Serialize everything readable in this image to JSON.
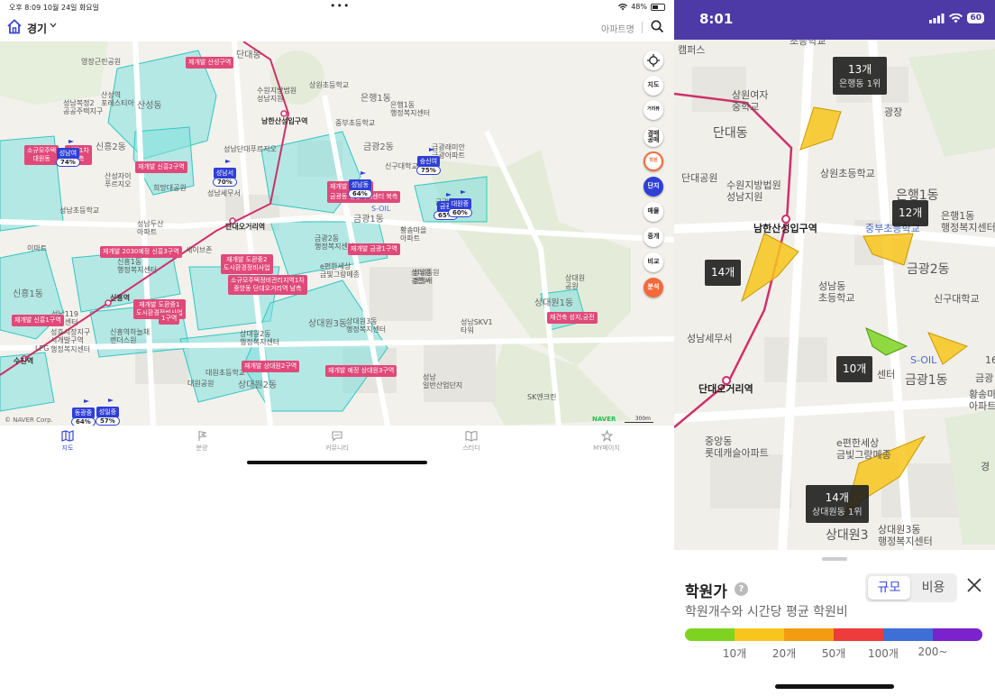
{
  "ipad": {
    "status": {
      "time": "오후 8:09",
      "date": "10월 24일 화요일",
      "battery": "48%",
      "battery_level": 0.48
    },
    "header": {
      "region": "경기",
      "apartment_name": "아파트명"
    },
    "map": {
      "labels": [
        {
          "t": "단대동"
        },
        {
          "t": "은행1동"
        },
        {
          "t": "금광2동"
        },
        {
          "t": "신흥2동"
        },
        {
          "t": "산성동"
        },
        {
          "t": "신흥1동"
        },
        {
          "t": "상대원3동"
        },
        {
          "t": "상대원1동"
        },
        {
          "t": "상대원2동"
        },
        {
          "t": "금광1동"
        },
        {
          "t": "수진역"
        },
        {
          "t": "신흥역"
        },
        {
          "t": "단대오거리역"
        },
        {
          "t": "남한산성입구역"
        },
        {
          "t": "영장근린공원"
        },
        {
          "t": "성남복정2\n공공주택지구"
        },
        {
          "t": "산성역\n포레스티아"
        },
        {
          "t": "상원초등학교"
        },
        {
          "t": "은행1동\n행정복지센터"
        },
        {
          "t": "중부초등학교"
        },
        {
          "t": "금광2동\n행정복지센터"
        },
        {
          "t": "신구대학교"
        },
        {
          "t": "성남단대푸르지오"
        },
        {
          "t": "희망대공원"
        },
        {
          "t": "성남세무서"
        },
        {
          "t": "성남초등학교"
        },
        {
          "t": "성남두산\n아파트"
        },
        {
          "t": "세이브존"
        },
        {
          "t": "신흥1동\n행정복지센터"
        },
        {
          "t": "e편한세상\n금빛그랑메종"
        },
        {
          "t": "상대원\n경찰서"
        },
        {
          "t": "상대원3동\n행정복지센터"
        },
        {
          "t": "상대원2동\n행정복지센터"
        },
        {
          "t": "대원초등학교"
        },
        {
          "t": "대원공원"
        },
        {
          "t": "성남\n일반산업단지"
        },
        {
          "t": "SK엔크린"
        },
        {
          "t": "상대원\n공원"
        },
        {
          "t": "성호시장지구\n시개발구역"
        },
        {
          "t": "신흥역하늘채\n랜더스원"
        },
        {
          "t": "성남SKV1\n타워"
        },
        {
          "t": "S-OIL"
        },
        {
          "t": "이마트"
        },
        {
          "t": "금광래미안\n금광아파트"
        },
        {
          "t": "수원지방법원\n성남지원"
        },
        {
          "t": "산성자이\n푸르지오"
        },
        {
          "t": "황송마을\n아파트"
        },
        {
          "t": "성남119\n안전센터"
        },
        {
          "t": "LPG"
        },
        {
          "t": "행정복지센터"
        },
        {
          "t": "금광중"
        },
        {
          "t": "성남중원\n경찰서"
        }
      ],
      "redev": [
        {
          "t": "제개발 산성구역"
        },
        {
          "t": "소규모주택\n대원동"
        },
        {
          "t": "재개발 신흥2구역"
        },
        {
          "t": "재개발 금광1구역"
        },
        {
          "t": "재개발 2030예정 신흥3구역"
        },
        {
          "t": "재개발 도환중2\n도시환경정비사업"
        },
        {
          "t": "소규모주택정비관리지역1차\n중앙동 단대오거리역 남측"
        },
        {
          "t": "재개발 도환중1\n도시환경정비사업"
        },
        {
          "t": "재개발 신흥1구역"
        },
        {
          "t": "재개발 상대원2구역"
        },
        {
          "t": "재개발 예정 상대원3구역"
        },
        {
          "t": "재건축 성지,궁전"
        },
        {
          "t": "재개발 금광7차"
        },
        {
          "t": "금광동 행정복지센터 북측"
        },
        {
          "t": "지역1차\n남측"
        },
        {
          "t": "1구역"
        }
      ],
      "flags": [
        {
          "name": "성남여",
          "pct": "74%",
          "pct_value": 74
        },
        {
          "name": "성남서",
          "pct": "70%",
          "pct_value": 70
        },
        {
          "name": "성남동",
          "pct": "64%",
          "pct_value": 64
        },
        {
          "name": "숭신여",
          "pct": "75%",
          "pct_value": 75
        },
        {
          "name": "금광",
          "pct": "65%",
          "pct_value": 65
        },
        {
          "name": "대원중",
          "pct": "60%",
          "pct_value": 60
        },
        {
          "name": "동광중",
          "pct": "64%",
          "pct_value": 64
        },
        {
          "name": "성일중",
          "pct": "57%",
          "pct_value": 57
        }
      ],
      "side_buttons": [
        "지도",
        "거리뷰",
        "경매\n공매",
        "학원",
        "단지",
        "매물",
        "중개",
        "비교",
        "분석"
      ],
      "copyright": "© NAVER Corp.",
      "naver": "NAVER",
      "scale": "300m"
    },
    "tabs": [
      {
        "label": "지도",
        "icon": "map-icon"
      },
      {
        "label": "분양",
        "icon": "flag-icon"
      },
      {
        "label": "커뮤니티",
        "icon": "chat-icon"
      },
      {
        "label": "스터디",
        "icon": "book-icon"
      },
      {
        "label": "MY페이지",
        "icon": "star-icon"
      }
    ]
  },
  "iphone": {
    "status": {
      "time": "8:01",
      "battery": "60"
    },
    "map": {
      "labels": [
        {
          "t": "캠퍼스"
        },
        {
          "t": "초등학교"
        },
        {
          "t": "상원여자\n중학교"
        },
        {
          "t": "단대동"
        },
        {
          "t": "광장"
        },
        {
          "t": "단대공원"
        },
        {
          "t": "수원지방법원\n성남지원"
        },
        {
          "t": "상원초등학교"
        },
        {
          "t": "은행1동"
        },
        {
          "t": "은행1동\n행정복지센터"
        },
        {
          "t": "남한산성입구역"
        },
        {
          "t": "중부초등학교"
        },
        {
          "t": "금광2동"
        },
        {
          "t": "신구대학교"
        },
        {
          "t": "성남동\n초등학교"
        },
        {
          "t": "성남세무서"
        },
        {
          "t": "S-OIL"
        },
        {
          "t": "센터"
        },
        {
          "t": "금광1동"
        },
        {
          "t": "금광"
        },
        {
          "t": "황송마을\n아파트"
        },
        {
          "t": "단대오거리역"
        },
        {
          "t": "중앙동\n롯데캐슬아파트"
        },
        {
          "t": "e편한세상\n금빛그랑메종"
        },
        {
          "t": "상대원3동\n행정복지센터"
        },
        {
          "t": "상대원3"
        },
        {
          "t": "경"
        },
        {
          "t": "16"
        }
      ],
      "counts": [
        {
          "count": "13개",
          "sub": "은행동 1위"
        },
        {
          "count": "12개",
          "sub": ""
        },
        {
          "count": "14개",
          "sub": ""
        },
        {
          "count": "10개",
          "sub": ""
        },
        {
          "count": "14개",
          "sub": "상대원동 1위"
        }
      ]
    },
    "sheet": {
      "title": "학원가",
      "help": "?",
      "toggle_on": "규모",
      "toggle_off": "비용",
      "subtitle": "학원개수와 시간당 평균 학원비",
      "legend_colors": [
        "#7ed321",
        "#f8c51c",
        "#f39c12",
        "#ee3b3b",
        "#3d6fd6",
        "#7b22cc"
      ],
      "legend_labels": [
        "10개",
        "20개",
        "50개",
        "100개",
        "200~"
      ]
    }
  }
}
